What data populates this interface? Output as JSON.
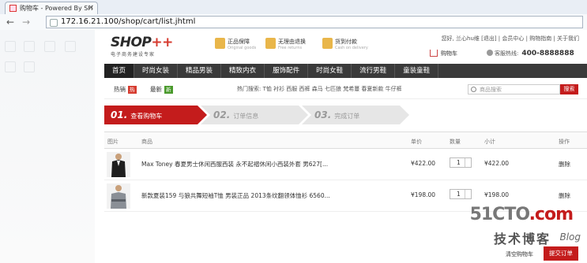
{
  "browser": {
    "tab_title": "购物车 - Powered By SH",
    "tab_close": "×",
    "back_glyph": "←",
    "forward_glyph": "→",
    "url": "172.16.21.100/shop/cart/list.jhtml"
  },
  "header": {
    "logo": "SHOP",
    "logo_plus": "++",
    "slogan": "电子商务建设专家",
    "features": [
      {
        "title": "正品保障",
        "sub": "Original goods"
      },
      {
        "title": "无理由退换",
        "sub": "Free returns"
      },
      {
        "title": "货到付款",
        "sub": "Cash on delivery"
      }
    ],
    "top_links": "您好, 兰心hu维 [退出] | 会员中心 | 购物指南 | 关于我们",
    "cart_label": "购物车",
    "hotline_label": "客服热线:",
    "hotline_number": "400-8888888"
  },
  "nav": {
    "items": [
      "首页",
      "时尚女装",
      "精品男装",
      "精致内衣",
      "服饰配件",
      "时尚女鞋",
      "流行男鞋",
      "童装童鞋"
    ]
  },
  "hot": {
    "hot_label": "热销",
    "hot_badge": "热",
    "new_label": "最新",
    "new_badge": "新",
    "keywords": "热门搜索: T恤 衬衫 西服 西裤 森马 七匹狼 梵希蔓 春夏新款 牛仔裤",
    "search_placeholder": "商品搜索",
    "search_button": "搜索"
  },
  "steps": [
    {
      "num": "01.",
      "label": "查看购物车"
    },
    {
      "num": "02.",
      "label": "订单信息"
    },
    {
      "num": "03.",
      "label": "完成订单"
    }
  ],
  "table": {
    "headers": {
      "image": "图片",
      "product": "商品",
      "price": "单价",
      "quantity": "数量",
      "subtotal": "小计",
      "action": "操作"
    },
    "rows": [
      {
        "name": "Max Toney 春夏男士休闲西服西装 永不起褶休闲小西装外套 男627[...",
        "price": "¥422.00",
        "quantity": "1",
        "subtotal": "¥422.00",
        "action": "删除"
      },
      {
        "name": "新款夏装159 与狼共舞短袖T恤 男装正品 2013条纹翻领体恤衫 6560...",
        "price": "¥198.00",
        "quantity": "1",
        "subtotal": "¥198.00",
        "action": "删除"
      }
    ]
  },
  "footer": {
    "clear_cart": "清空购物车",
    "submit_order": "提交订单"
  },
  "watermark": {
    "line1": "51CTO",
    "line1_suffix": ".com",
    "line2": "技术博客",
    "line3": "Blog"
  },
  "colors": {
    "brand_red": "#c41c1c",
    "nav_dark": "#3a3a3a",
    "step_gray": "#e6e6e6"
  }
}
